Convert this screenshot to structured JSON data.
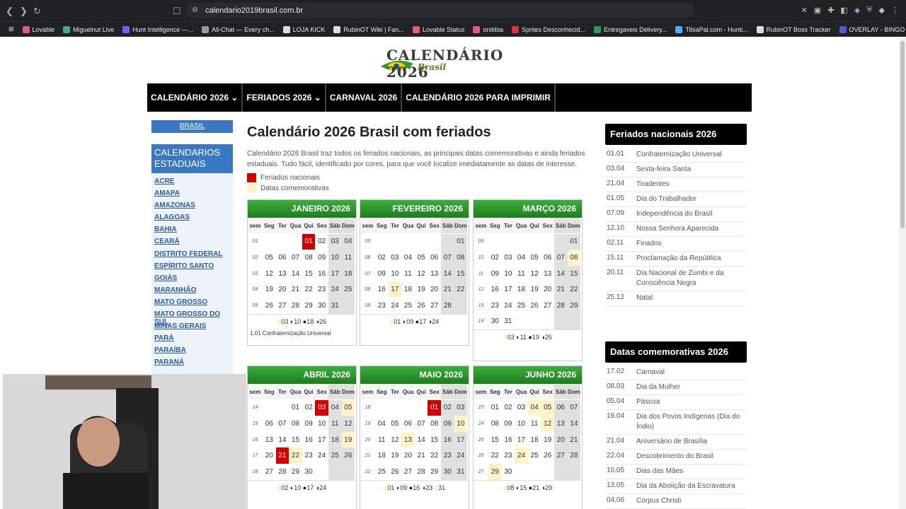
{
  "browser": {
    "url": "calendario2019brasil.com.br"
  },
  "bookmarks": [
    {
      "label": "Lovable",
      "color": "#e25b7f"
    },
    {
      "label": "Miguelnut Live",
      "color": "#4a8"
    },
    {
      "label": "Hunt Intelligence —...",
      "color": "#7a5cf0"
    },
    {
      "label": "All-Chat — Every ch...",
      "color": "#999"
    },
    {
      "label": "LOJA KICK",
      "color": "#ddd"
    },
    {
      "label": "RubinOT Wiki | Fan...",
      "color": "#ddd"
    },
    {
      "label": "Lovable Status",
      "color": "#e25b7f"
    },
    {
      "label": "onitibia",
      "color": "#e25b7f"
    },
    {
      "label": "Sprites Desconhecid...",
      "color": "#d33"
    },
    {
      "label": "Entregaveis Delivery...",
      "color": "#2a9d4a"
    },
    {
      "label": "TibiaPal.com - Hunti...",
      "color": "#5af"
    },
    {
      "label": "RubinOT Boss Tracker",
      "color": "#ddd"
    },
    {
      "label": "OVERLAY - BINGO",
      "color": "#4f5bd5"
    }
  ],
  "logo": {
    "title": "CALENDÁRIO 2026",
    "sub": "Brasil"
  },
  "topnav": [
    "CALENDÁRIO 2026 ⌄",
    "FERIADOS 2026 ⌄",
    "CARNAVAL 2026",
    "CALENDÁRIO 2026 PARA IMPRIMIR"
  ],
  "sidebar": {
    "brasil": "BRASIL",
    "states_title": "CALENDARIOS ESTADUAIS",
    "states": [
      "ACRE",
      "AMAPA",
      "AMAZONAS",
      "ALAGOAS",
      "BAHIA",
      "CEARÁ",
      "DISTRITO FEDERAL",
      "ESPÍRITO SANTO",
      "GOIÁS",
      "MARANHÃO",
      "MATO GROSSO",
      "MATO GROSSO DO SUL",
      "MINAS GERAIS",
      "PARÁ",
      "PARAÍBA",
      "PARANÁ"
    ]
  },
  "main": {
    "title": "Calendário 2026 Brasil com feriados",
    "intro": "Calendário 2026 Brasil traz todos os feriados nacionais, as principais datas comemorativas e ainda feriados estaduais. Tudo fácil, identificado por cores, para que você localize imediatamente as datas de interesse.",
    "legend_holiday": "Feriados nacionais",
    "legend_commem": "Datas comemorativas"
  },
  "weekday_headers": [
    "sem",
    "Seg",
    "Ter",
    "Qua",
    "Qui",
    "Sex",
    "Sáb",
    "Dom"
  ],
  "months": [
    {
      "name": "JANEIRO 2026",
      "first": 4,
      "days": 31,
      "weeks": [
        "01",
        "02",
        "03",
        "04",
        "05"
      ],
      "hol": [
        1
      ],
      "com": [],
      "moons": [
        "03",
        "10",
        "18",
        "26"
      ],
      "note": "1.01 Confraternização Universal"
    },
    {
      "name": "FEVEREIRO 2026",
      "first": 7,
      "days": 28,
      "weeks": [
        "05",
        "06",
        "07",
        "08",
        "09"
      ],
      "hol": [],
      "com": [
        17
      ],
      "moons": [
        "01",
        "09",
        "17",
        "24"
      ],
      "note": ""
    },
    {
      "name": "MARÇO 2026",
      "first": 7,
      "days": 31,
      "weeks": [
        "09",
        "10",
        "11",
        "12",
        "13",
        "14"
      ],
      "hol": [],
      "com": [
        8
      ],
      "moons": [
        "03",
        "11",
        "19",
        "25"
      ],
      "note": ""
    },
    {
      "name": "ABRIL 2026",
      "first": 3,
      "days": 30,
      "weeks": [
        "14",
        "15",
        "16",
        "17",
        "18"
      ],
      "hol": [
        3,
        21
      ],
      "com": [
        5,
        19,
        22
      ],
      "moons": [
        "02",
        "10",
        "17",
        "24"
      ],
      "note": ""
    },
    {
      "name": "MAIO 2026",
      "first": 5,
      "days": 31,
      "weeks": [
        "18",
        "19",
        "20",
        "21",
        "22"
      ],
      "hol": [
        1
      ],
      "com": [
        10,
        13
      ],
      "moons": [
        "01",
        "09",
        "16",
        "23",
        "31"
      ],
      "note": ""
    },
    {
      "name": "JUNHO 2026",
      "first": 1,
      "days": 30,
      "weeks": [
        "23",
        "24",
        "25",
        "26",
        "27"
      ],
      "hol": [],
      "com": [
        4,
        5,
        12,
        24,
        29
      ],
      "moons": [
        "08",
        "15",
        "21",
        "29"
      ],
      "note": ""
    }
  ],
  "holidays_title": "Feriados nacionais 2026",
  "holidays": [
    {
      "d": "01.01",
      "n": "Confraternização Universal"
    },
    {
      "d": "03.04",
      "n": "Sexta-feira Santa"
    },
    {
      "d": "21.04",
      "n": "Tiradentes"
    },
    {
      "d": "01.05",
      "n": "Dia do Trabalhador"
    },
    {
      "d": "07.09",
      "n": "Independência do Brasil"
    },
    {
      "d": "12.10",
      "n": "Nossa Senhora Aparecida"
    },
    {
      "d": "02.11",
      "n": "Finados"
    },
    {
      "d": "15.11",
      "n": "Proclamação da República"
    },
    {
      "d": "20.11",
      "n": "Dia Nacional de Zumbi e da Consciência Negra"
    },
    {
      "d": "25.12",
      "n": "Natal"
    }
  ],
  "commem_title": "Datas comemorativas 2026",
  "commem": [
    {
      "d": "17.02",
      "n": "Carnaval"
    },
    {
      "d": "08.03",
      "n": "Dia da Mulher"
    },
    {
      "d": "05.04",
      "n": "Páscoa"
    },
    {
      "d": "19.04",
      "n": "Dia dos Povos Indígenas (Dia do Índio)"
    },
    {
      "d": "21.04",
      "n": "Aniversário de Brasília"
    },
    {
      "d": "22.04",
      "n": "Descobrimento do Brasil"
    },
    {
      "d": "10.05",
      "n": "Dias das Mães"
    },
    {
      "d": "13.05",
      "n": "Dia da Abolição da Escravatura"
    },
    {
      "d": "04.06",
      "n": "Corpus Christi"
    }
  ],
  "colors": {
    "holiday": "#d40000",
    "commem": "#fdf2c8",
    "header_green": "#2a9a2a",
    "nav_black": "#000000",
    "link_blue": "#2a5aa6"
  }
}
